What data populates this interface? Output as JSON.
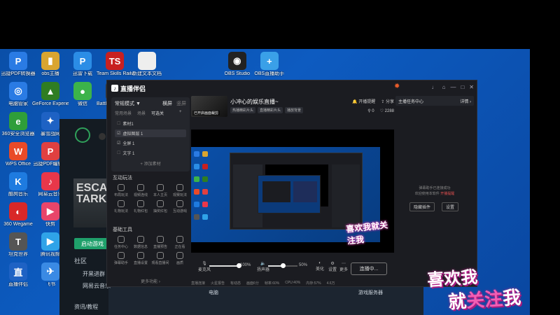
{
  "desktop": {
    "icons": [
      {
        "label": "迅捷PDF转换器",
        "color": "#2a7be4",
        "glyph": "P"
      },
      {
        "label": "obs主播",
        "color": "#d9a530",
        "glyph": "▮"
      },
      {
        "label": "迅雷下载",
        "color": "#2b8de6",
        "glyph": "P"
      },
      {
        "label": "Team Skills Railway Sim",
        "color": "#c82020",
        "glyph": "TS"
      },
      {
        "label": "新建文本文档",
        "color": "#eeeeee",
        "glyph": ""
      },
      {
        "label": "OBS Studio",
        "color": "#222222",
        "glyph": "◉"
      },
      {
        "label": "OBS直播助手",
        "color": "#3aa0e8",
        "glyph": "+"
      },
      {
        "label": "电脑管家",
        "color": "#2a7be4",
        "glyph": "◎"
      },
      {
        "label": "GeForce Experience",
        "color": "#2f7d22",
        "glyph": "▲"
      },
      {
        "label": "微信",
        "color": "#3cb34a",
        "glyph": "●"
      },
      {
        "label": "Battlestate Games",
        "color": "#333333",
        "glyph": "A"
      },
      {
        "label": "360安全浏览器",
        "color": "#2f9e3a",
        "glyph": "e"
      },
      {
        "label": "暴雪战网",
        "color": "#1e62c4",
        "glyph": "✦"
      },
      {
        "label": "WPS Office",
        "color": "#e94a28",
        "glyph": "W"
      },
      {
        "label": "迅捷PDF编辑器",
        "color": "#e04040",
        "glyph": "P"
      },
      {
        "label": "酷狗音乐",
        "color": "#1e7be0",
        "glyph": "K"
      },
      {
        "label": "网易云音乐",
        "color": "#e8374a",
        "glyph": "♪"
      },
      {
        "label": "360 Wegame",
        "color": "#d82828",
        "glyph": "◐"
      },
      {
        "label": "快剪",
        "color": "#e8456a",
        "glyph": "▶"
      },
      {
        "label": "坦克世界",
        "color": "#555555",
        "glyph": "T"
      },
      {
        "label": "腾讯视频",
        "color": "#2fa3e8",
        "glyph": "▶"
      },
      {
        "label": "直播伴侣",
        "color": "#1e62c4",
        "glyph": "直"
      },
      {
        "label": "飞书",
        "color": "#3a8ae4",
        "glyph": "✈"
      }
    ]
  },
  "steam": {
    "banner": "ESCAPE TARK",
    "start_button": "启动游戏",
    "community": "社区",
    "item1": "开黑进群",
    "item2": "网易云音乐",
    "news": "资讯/教程",
    "computer": "电脑",
    "server": "游戏服务器"
  },
  "app": {
    "title": "直播伴侣",
    "window_controls": [
      "♩",
      "⌂",
      "—",
      "□",
      "✕"
    ],
    "mode": {
      "label": "常规模式 ▼",
      "landscape": "横屏",
      "portrait": "竖屏"
    },
    "scene_tabs": [
      "常用场景",
      "场景",
      "可选关"
    ],
    "scenes": [
      {
        "name": "素材1",
        "active": false
      },
      {
        "name": "虚拟图层 1",
        "active": true
      },
      {
        "name": "全屏 1",
        "active": false
      },
      {
        "name": "文字 1",
        "active": false
      }
    ],
    "add_source": "+ 添加素材",
    "interact_title": "互动玩法",
    "interact_tools": [
      "布局玩法",
      "视频连线",
      "本人主页",
      "观赛玩法",
      "礼物玩法",
      "礼物红包",
      "抽奖红包",
      "互动游戏"
    ],
    "basic_title": "基础工具",
    "basic_tools": [
      "任务中心",
      "数据信息",
      "直播预告",
      "正在看",
      "弹幕助手",
      "直播设置",
      "观看直播间",
      "画质"
    ],
    "more": "更多功能 ›",
    "stream": {
      "cover_text": "已开启画面裁剪",
      "title": "小冲心的娱乐直播~",
      "tags": [
        "热播精彩片头",
        "直播精彩片头",
        "播放背景"
      ],
      "action1": "开播提醒",
      "action2": "分享",
      "likes": "0",
      "hearts": "2288"
    },
    "controls": {
      "mic_label": "麦克风",
      "mic_pct": "100%",
      "mic_level": 1.0,
      "speaker_label": "扬声器",
      "speaker_pct": "50%",
      "speaker_level": 0.5,
      "btn1": "美化",
      "btn2": "设置",
      "btn3": "更多",
      "start": "连播中..."
    },
    "status": [
      "直播连接",
      "火星报告",
      "有动态",
      "画面6分",
      "帧率:60%",
      "CPU:40%",
      "内存:57%",
      "4.6万"
    ],
    "assistant": {
      "title": "主播任务中心",
      "detail": "详情 ›",
      "msg_line1": "弹幕助手已连接成功",
      "msg_line2": "欢迎使用本软件",
      "msg_warn": "开播提醒",
      "btn_left": "隐藏插件",
      "btn_right": "设置"
    }
  },
  "overlay": {
    "line1": "喜欢我",
    "line2_a": "就",
    "line2_b": "关注",
    "line2_c": "我"
  },
  "preview_stamp": "喜欢我就关注我"
}
